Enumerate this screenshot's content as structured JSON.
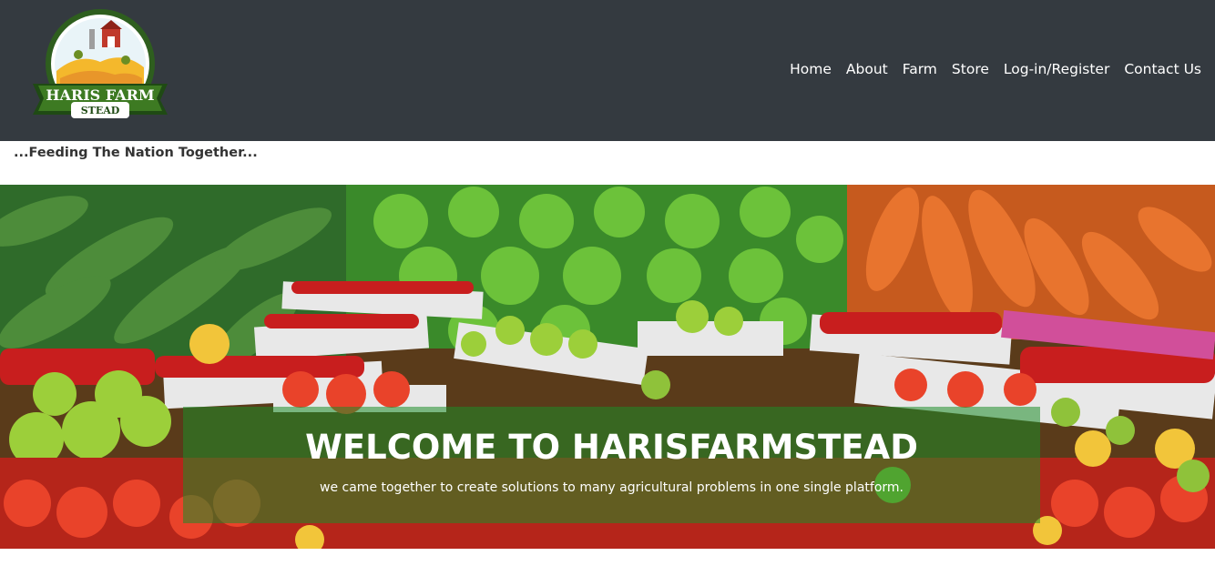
{
  "brand": {
    "logo_line1": "HARIS FARM",
    "logo_line2": "STEAD"
  },
  "nav": {
    "items": [
      {
        "label": "Home"
      },
      {
        "label": "About"
      },
      {
        "label": "Farm"
      },
      {
        "label": "Store"
      },
      {
        "label": "Log-in/Register"
      },
      {
        "label": "Contact Us"
      }
    ]
  },
  "tagline": "...Feeding The Nation Together...",
  "hero": {
    "title": "WELCOME TO HARISFARMSTEAD",
    "subtitle": "we came together to create solutions to many agricultural problems in one single platform."
  },
  "colors": {
    "header_bg": "#343a40",
    "overlay": "rgba(30,140,40,0.55)"
  }
}
